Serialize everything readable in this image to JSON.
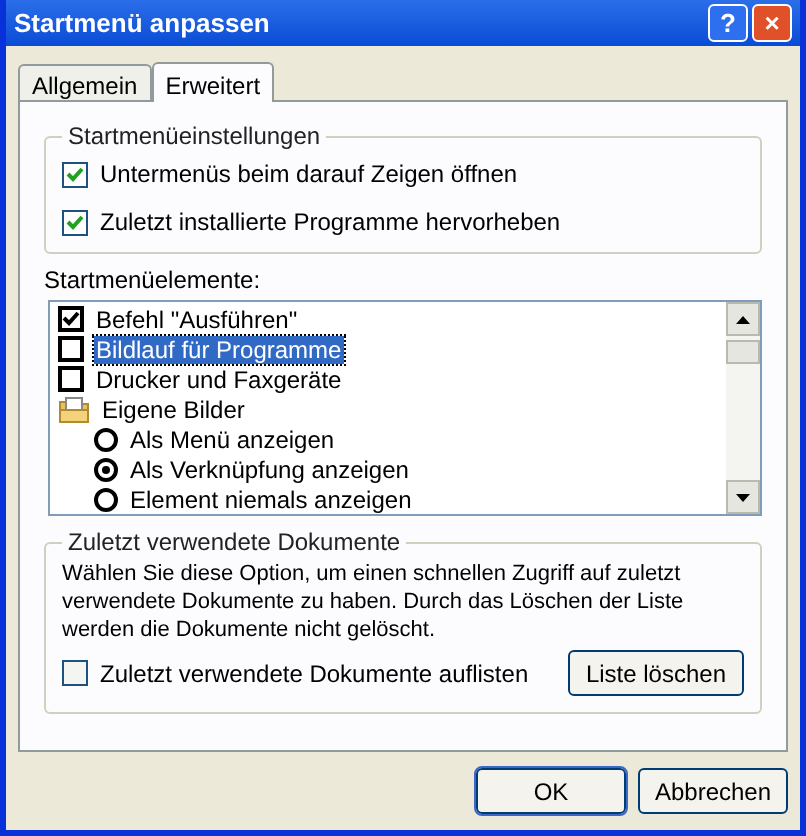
{
  "window": {
    "title": "Startmenü anpassen",
    "controls": [
      "?",
      "×"
    ]
  },
  "tabs": [
    {
      "label": "Allgemein",
      "selected": false
    },
    {
      "label": "Erweitert",
      "selected": true
    }
  ],
  "settings_group": {
    "title": "Startmenüeinstellungen",
    "options": [
      {
        "label": "Untermenüs beim darauf Zeigen öffnen",
        "checked": true
      },
      {
        "label": "Zuletzt installierte Programme hervorheben",
        "checked": true
      }
    ]
  },
  "elements": {
    "label": "Startmenüelemente:",
    "items": [
      {
        "kind": "checkbox",
        "label": "Befehl \"Ausführen\"",
        "checked": true,
        "selected": false
      },
      {
        "kind": "checkbox",
        "label": "Bildlauf für Programme",
        "checked": false,
        "selected": true
      },
      {
        "kind": "checkbox",
        "label": "Drucker und Faxgeräte",
        "checked": false,
        "selected": false
      },
      {
        "kind": "folder",
        "label": "Eigene Bilder",
        "selected": false
      },
      {
        "kind": "radio",
        "label": "Als Menü anzeigen",
        "checked": false,
        "selected": false
      },
      {
        "kind": "radio",
        "label": "Als Verknüpfung anzeigen",
        "checked": true,
        "selected": false
      },
      {
        "kind": "radio",
        "label": "Element niemals anzeigen",
        "checked": false,
        "selected": false
      }
    ]
  },
  "documents_group": {
    "title": "Zuletzt verwendete Dokumente",
    "description": "Wählen Sie diese Option, um einen schnellen Zugriff auf zuletzt verwendete Dokumente zu haben. Durch das Löschen der Liste werden die Dokumente nicht gelöscht.",
    "option": {
      "label": "Zuletzt verwendete Dokumente auflisten",
      "checked": false
    },
    "button": "Liste löschen"
  },
  "buttons": [
    "OK",
    "Abbrechen"
  ]
}
